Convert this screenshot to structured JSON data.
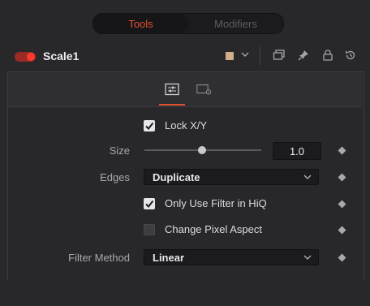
{
  "tabs": [
    {
      "label": "Tools",
      "active": true
    },
    {
      "label": "Modifiers",
      "active": false
    }
  ],
  "tool": {
    "name": "Scale1",
    "enabled": true,
    "color_swatch": "#d3ad8b"
  },
  "header_icons": [
    "chevron-down-icon",
    "overlapping-windows-icon",
    "pin-icon",
    "lock-icon",
    "reset-icon"
  ],
  "panel_tabs": [
    {
      "icon": "sliders-icon",
      "active": true
    },
    {
      "icon": "settings-window-icon",
      "active": false
    }
  ],
  "controls": {
    "lock_xy": {
      "label": "Lock X/Y",
      "checked": true
    },
    "size": {
      "label": "Size",
      "value": "1.0"
    },
    "edges": {
      "label": "Edges",
      "value": "Duplicate"
    },
    "only_use_filter": {
      "label": "Only Use Filter in HiQ",
      "checked": true
    },
    "change_pixel_aspect": {
      "label": "Change Pixel Aspect",
      "checked": false
    },
    "filter_method": {
      "label": "Filter Method",
      "value": "Linear"
    }
  },
  "colors": {
    "accent": "#e0512c",
    "background": "#28282b",
    "field": "#1b1b1d"
  }
}
